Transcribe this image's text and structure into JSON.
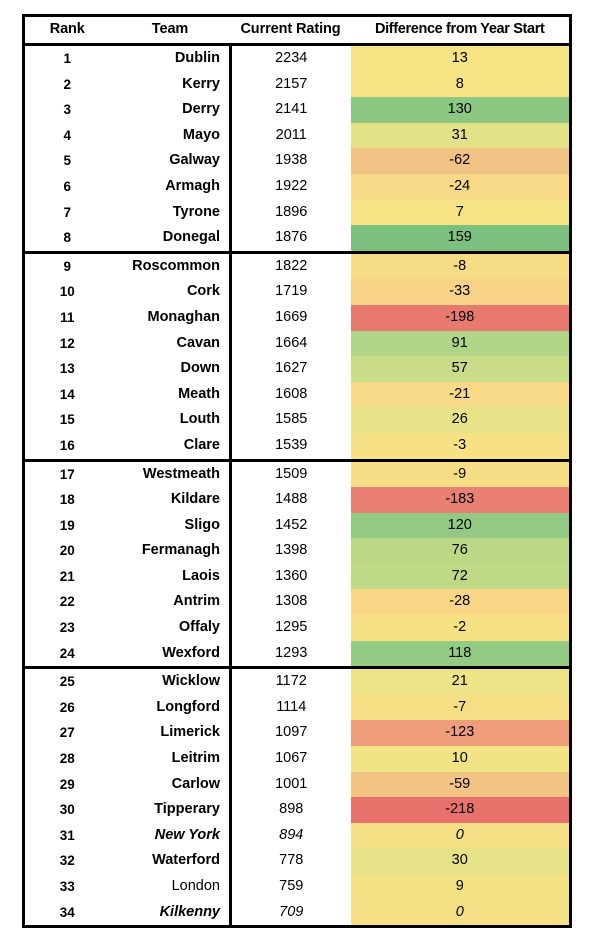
{
  "table": {
    "columns": [
      {
        "key": "rank",
        "label": "Rank"
      },
      {
        "key": "team",
        "label": "Team"
      },
      {
        "key": "rating",
        "label": "Current Rating"
      },
      {
        "key": "diff",
        "label": "Difference from Year Start"
      }
    ],
    "section_breaks_after_rank": [
      8,
      16,
      24
    ],
    "rows": [
      {
        "rank": "1",
        "team": "Dublin",
        "rating": "2234",
        "diff": "13",
        "color": "#f5e384",
        "style": "bold"
      },
      {
        "rank": "2",
        "team": "Kerry",
        "rating": "2157",
        "diff": "8",
        "color": "#f5e384",
        "style": "bold"
      },
      {
        "rank": "3",
        "team": "Derry",
        "rating": "2141",
        "diff": "130",
        "color": "#8cc882",
        "style": "bold"
      },
      {
        "rank": "4",
        "team": "Mayo",
        "rating": "2011",
        "diff": "31",
        "color": "#e4e289",
        "style": "bold"
      },
      {
        "rank": "5",
        "team": "Galway",
        "rating": "1938",
        "diff": "-62",
        "color": "#f0c384",
        "style": "bold"
      },
      {
        "rank": "6",
        "team": "Armagh",
        "rating": "1922",
        "diff": "-24",
        "color": "#f8d987",
        "style": "bold"
      },
      {
        "rank": "7",
        "team": "Tyrone",
        "rating": "1896",
        "diff": "7",
        "color": "#f5e384",
        "style": "bold"
      },
      {
        "rank": "8",
        "team": "Donegal",
        "rating": "1876",
        "diff": "159",
        "color": "#7cc17f",
        "style": "bold"
      },
      {
        "rank": "9",
        "team": "Roscommon",
        "rating": "1822",
        "diff": "-8",
        "color": "#f6dd85",
        "style": "bold"
      },
      {
        "rank": "10",
        "team": "Cork",
        "rating": "1719",
        "diff": "-33",
        "color": "#f8d286",
        "style": "bold"
      },
      {
        "rank": "11",
        "team": "Monaghan",
        "rating": "1669",
        "diff": "-198",
        "color": "#e8796f",
        "style": "bold"
      },
      {
        "rank": "12",
        "team": "Cavan",
        "rating": "1664",
        "diff": "91",
        "color": "#b0d488",
        "style": "bold"
      },
      {
        "rank": "13",
        "team": "Down",
        "rating": "1627",
        "diff": "57",
        "color": "#c9dc87",
        "style": "bold"
      },
      {
        "rank": "14",
        "team": "Meath",
        "rating": "1608",
        "diff": "-21",
        "color": "#f7d987",
        "style": "bold"
      },
      {
        "rank": "15",
        "team": "Louth",
        "rating": "1585",
        "diff": "26",
        "color": "#e8e388",
        "style": "bold"
      },
      {
        "rank": "16",
        "team": "Clare",
        "rating": "1539",
        "diff": "-3",
        "color": "#f7e185",
        "style": "bold"
      },
      {
        "rank": "17",
        "team": "Westmeath",
        "rating": "1509",
        "diff": "-9",
        "color": "#f6dd85",
        "style": "bold"
      },
      {
        "rank": "18",
        "team": "Kildare",
        "rating": "1488",
        "diff": "-183",
        "color": "#e98073",
        "style": "bold"
      },
      {
        "rank": "19",
        "team": "Sligo",
        "rating": "1452",
        "diff": "120",
        "color": "#92ca83",
        "style": "bold"
      },
      {
        "rank": "20",
        "team": "Fermanagh",
        "rating": "1398",
        "diff": "76",
        "color": "#bcd887",
        "style": "bold"
      },
      {
        "rank": "21",
        "team": "Laois",
        "rating": "1360",
        "diff": "72",
        "color": "#bfd987",
        "style": "bold"
      },
      {
        "rank": "22",
        "team": "Antrim",
        "rating": "1308",
        "diff": "-28",
        "color": "#f8d686",
        "style": "bold"
      },
      {
        "rank": "23",
        "team": "Offaly",
        "rating": "1295",
        "diff": "-2",
        "color": "#f6e285",
        "style": "bold"
      },
      {
        "rank": "24",
        "team": "Wexford",
        "rating": "1293",
        "diff": "118",
        "color": "#93cb83",
        "style": "bold"
      },
      {
        "rank": "25",
        "team": "Wicklow",
        "rating": "1172",
        "diff": "21",
        "color": "#ece487",
        "style": "bold"
      },
      {
        "rank": "26",
        "team": "Longford",
        "rating": "1114",
        "diff": "-7",
        "color": "#f6de85",
        "style": "bold"
      },
      {
        "rank": "27",
        "team": "Limerick",
        "rating": "1097",
        "diff": "-123",
        "color": "#f09d7c",
        "style": "bold"
      },
      {
        "rank": "28",
        "team": "Leitrim",
        "rating": "1067",
        "diff": "10",
        "color": "#f2e485",
        "style": "bold"
      },
      {
        "rank": "29",
        "team": "Carlow",
        "rating": "1001",
        "diff": "-59",
        "color": "#f4c485",
        "style": "bold"
      },
      {
        "rank": "30",
        "team": "Tipperary",
        "rating": "898",
        "diff": "-218",
        "color": "#e8726b",
        "style": "bold"
      },
      {
        "rank": "31",
        "team": "New York",
        "rating": "894",
        "diff": "0",
        "color": "#f6e085",
        "style": "italic"
      },
      {
        "rank": "32",
        "team": "Waterford",
        "rating": "778",
        "diff": "30",
        "color": "#e5e288",
        "style": "bold"
      },
      {
        "rank": "33",
        "team": "London",
        "rating": "759",
        "diff": "9",
        "color": "#f4e384",
        "style": "plain"
      },
      {
        "rank": "34",
        "team": "Kilkenny",
        "rating": "709",
        "diff": "0",
        "color": "#f6e085",
        "style": "italic"
      }
    ]
  }
}
